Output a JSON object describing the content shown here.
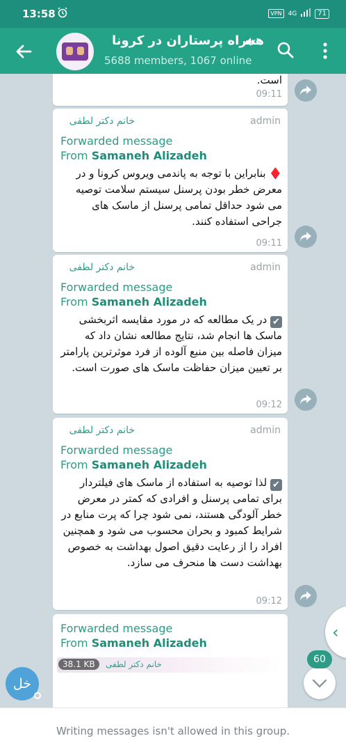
{
  "status_bar": {
    "time": "13:58",
    "vpn": "VPN",
    "network": "4G",
    "battery": "71"
  },
  "header": {
    "title": "همراه پرستاران در کرونا",
    "subtitle": "5688 members, 1067 online"
  },
  "messages": [
    {
      "text": "است.",
      "time": "09:11"
    },
    {
      "sender": "خانم دکتر لطفی",
      "role": "admin",
      "forward_line": "Forwarded message",
      "from_prefix": "From ",
      "from_name": "Samaneh Alizadeh",
      "marker": "♦️",
      "text": "بنابراین با توجه به پاندمی ویروس کرونا و در معرض خطر بودن پرسنل سیستم سلامت توصیه می شود حداقل تمامی پرسنل از ماسک های جراحی استفاده کنند.",
      "time": "09:11"
    },
    {
      "sender": "خانم دکتر لطفی",
      "role": "admin",
      "forward_line": "Forwarded message",
      "from_prefix": "From ",
      "from_name": "Samaneh Alizadeh",
      "marker": "✔",
      "text": "در یک مطالعه که در مورد مقایسه اثربخشی ماسک ها انجام شد، نتایج مطالعه نشان داد که میزان فاصله بین منبع آلوده از فرد موثرترین پارامتر بر تعیین میزان حفاظت ماسک های صورت است.",
      "time": "09:12"
    },
    {
      "sender": "خانم دکتر لطفی",
      "role": "admin",
      "forward_line": "Forwarded message",
      "from_prefix": "From ",
      "from_name": "Samaneh Alizadeh",
      "marker": "✔",
      "text": "لذا توصیه به استفاده از ماسک های فیلتردار برای تمامی پرسنل و افرادی که کمتر در معرض خطر آلودگی هستند، نمی شود چرا که پرت منابع در شرایط کمبود و بحران محسوب می شود و همچنین افراد را از رعایت دقیق اصول بهداشت به خصوص بهداشت دست ها منحرف می سازد.",
      "time": "09:12"
    },
    {
      "forward_line": "Forwarded message",
      "from_prefix": "From ",
      "from_name": "Samaneh Alizadeh",
      "file_size": "38.1 KB",
      "file_sender": "خانم دکتر لطفی"
    }
  ],
  "sender_avatar": {
    "initials": "خل"
  },
  "unread_count": "60",
  "footer": {
    "notice": "Writing messages isn't allowed in this group."
  },
  "colors": {
    "header": "#24a389",
    "status_bar": "#1f8f7d",
    "accent": "#2d9b86",
    "background": "#cdd9df"
  },
  "icons": [
    "back-arrow-icon",
    "mute-icon",
    "search-icon",
    "more-vert-icon",
    "share-icon",
    "chevron-down-icon",
    "chevron-left-icon",
    "alarm-icon"
  ]
}
